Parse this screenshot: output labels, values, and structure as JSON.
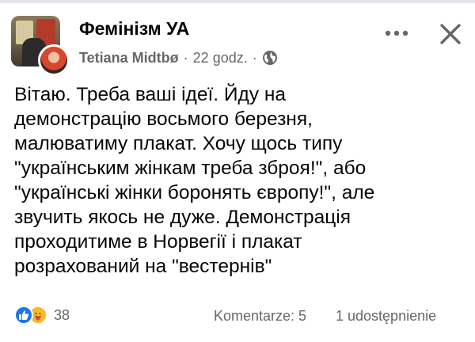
{
  "post": {
    "group_name": "Фемінізм УА",
    "author": "Tetiana Midtbø",
    "separator": "·",
    "time": "22 godz.",
    "privacy_icon": "globe-icon",
    "text": "Вітаю. Треба ваші ідеї. Йду на\nдемонстрацію восьмого березня,\nмалюватиму плакат. Хочу щось типу\n\"українським жінкам треба зброя!\", або\n\"українські жінки боронять європу!\", але\nзвучить якось не дуже. Демонстрація\nпроходитиме в Норвегії і плакат\nрозрахований на \"вестернів\""
  },
  "header_actions": {
    "more_icon": "more-horizontal-icon",
    "close_icon": "close-icon"
  },
  "footer": {
    "reaction_icons": [
      "like-icon",
      "care-icon"
    ],
    "reaction_count": "38",
    "comments": "Komentarze: 5",
    "shares": "1 udostępnienie"
  },
  "colors": {
    "text": "#050505",
    "secondary_text": "#65676b",
    "like_blue": "#1877f2",
    "care_yellow": "#f7b928"
  }
}
